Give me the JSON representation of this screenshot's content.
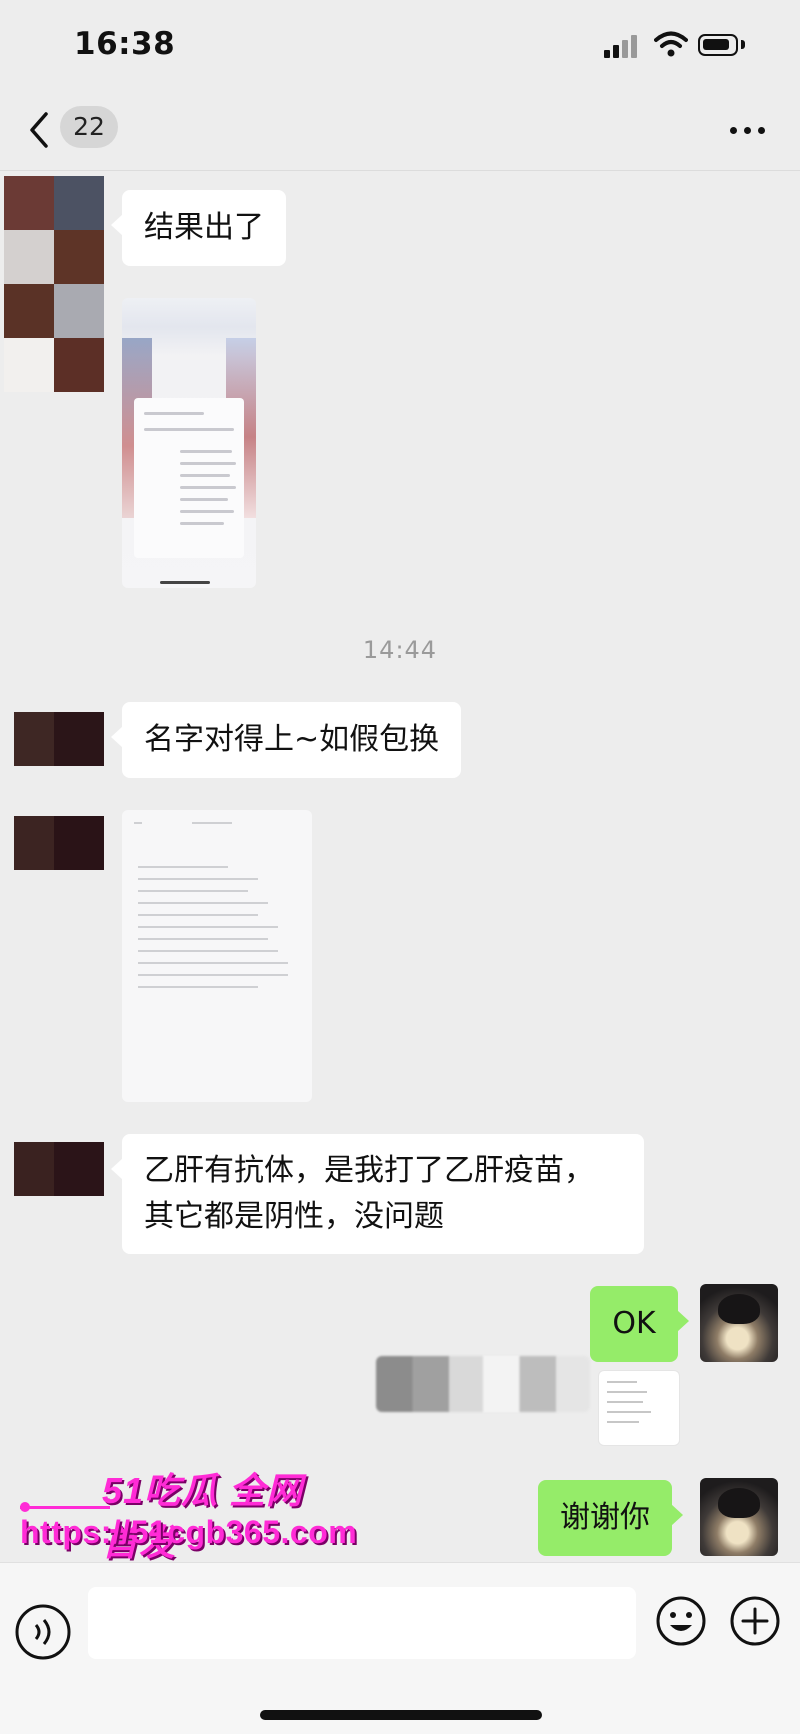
{
  "status_bar": {
    "time": "16:38"
  },
  "nav": {
    "unread_count": "22"
  },
  "messages": [
    {
      "side": "left",
      "type": "text",
      "text": "结果出了"
    },
    {
      "side": "left",
      "type": "image"
    },
    {
      "type": "timestamp",
      "text": "14:44"
    },
    {
      "side": "left",
      "type": "text",
      "text": "名字对得上~如假包换"
    },
    {
      "side": "left",
      "type": "image"
    },
    {
      "side": "left",
      "type": "text",
      "text": "乙肝有抗体，是我打了乙肝疫苗，其它都是阴性，没问题"
    },
    {
      "side": "right",
      "type": "text",
      "text": "OK"
    },
    {
      "side": "right",
      "type": "image"
    },
    {
      "side": "right",
      "type": "text",
      "text": "谢谢你"
    }
  ],
  "watermark": {
    "title": "51吃瓜 全网首发",
    "url": "https://51cgb365.com"
  },
  "input_bar": {
    "value": ""
  },
  "colors": {
    "background": "#ededed",
    "my_bubble": "#95ec69",
    "other_bubble": "#ffffff",
    "watermark": "#ff2bd6"
  },
  "icons": [
    "back-icon",
    "more-icon",
    "voice-icon",
    "emoji-icon",
    "plus-icon",
    "signal-icon",
    "wifi-icon",
    "battery-icon"
  ]
}
